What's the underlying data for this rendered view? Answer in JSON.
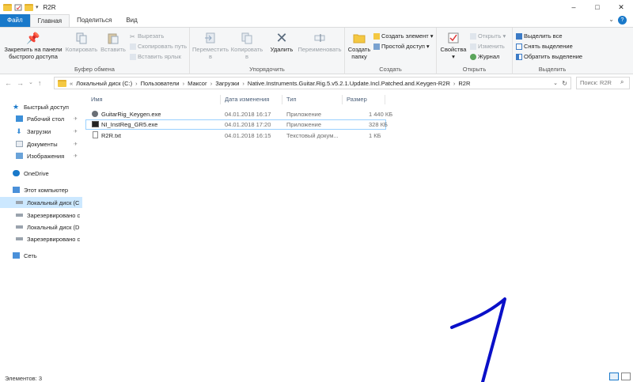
{
  "window": {
    "title": "R2R",
    "minimize": "–",
    "maximize": "□",
    "close": "✕"
  },
  "tabs": [
    "Файл",
    "Главная",
    "Поделиться",
    "Вид"
  ],
  "ribbon": {
    "clipboard": {
      "label": "Буфер обмена",
      "pin": "Закрепить на панели быстрого доступа",
      "copy": "Копировать",
      "paste": "Вставить",
      "cut": "Вырезать",
      "copy_path": "Скопировать путь",
      "paste_shortcut": "Вставить ярлык"
    },
    "organize": {
      "label": "Упорядочить",
      "move_to": "Переместить в",
      "copy_to": "Копировать в",
      "delete": "Удалить",
      "rename": "Переименовать"
    },
    "create": {
      "label": "Создать",
      "new_folder": "Создать папку",
      "new_item": "Создать элемент",
      "easy_access": "Простой доступ"
    },
    "open": {
      "label": "Открыть",
      "properties": "Свойства",
      "open": "Открыть",
      "edit": "Изменить",
      "history": "Журнал"
    },
    "select": {
      "label": "Выделить",
      "select_all": "Выделить все",
      "select_none": "Снять выделение",
      "invert": "Обратить выделение"
    }
  },
  "address": {
    "crumbs": [
      "Локальный диск (C:)",
      "Пользователи",
      "Максог",
      "Загрузки",
      "Native.Instruments.Guitar.Rig.5.v5.2.1.Update.Incl.Patched.and.Keygen-R2R",
      "R2R"
    ],
    "search_placeholder": "Поиск: R2R",
    "prefix": "«"
  },
  "sidebar": [
    {
      "label": "Быстрый доступ",
      "icon": "star-icon",
      "pinned": false
    },
    {
      "label": "Рабочий стол",
      "icon": "desktop-icon",
      "pinned": true
    },
    {
      "label": "Загрузки",
      "icon": "download-icon",
      "pinned": true
    },
    {
      "label": "Документы",
      "icon": "documents-icon",
      "pinned": true
    },
    {
      "label": "Изображения",
      "icon": "pictures-icon",
      "pinned": true
    },
    {
      "label": "OneDrive",
      "icon": "cloud-icon",
      "pinned": false
    },
    {
      "label": "Этот компьютер",
      "icon": "computer-icon",
      "pinned": false
    },
    {
      "label": "Локальный диск (C",
      "icon": "drive-icon",
      "pinned": false
    },
    {
      "label": "Зарезервировано с",
      "icon": "drive-icon",
      "pinned": false
    },
    {
      "label": "Локальный диск (D",
      "icon": "drive-icon",
      "pinned": false
    },
    {
      "label": "Зарезервировано с",
      "icon": "drive-icon",
      "pinned": false
    },
    {
      "label": "Сеть",
      "icon": "network-icon",
      "pinned": false
    }
  ],
  "pin_glyph": "✈",
  "columns": [
    "Имя",
    "Дата изменения",
    "Тип",
    "Размер"
  ],
  "files": [
    {
      "name": "GuitarRig_Keygen.exe",
      "date": "04.01.2018 16:17",
      "type": "Приложение",
      "size": "1 440 КБ",
      "icon": "app-icon"
    },
    {
      "name": "NI_InstReg_GR5.exe",
      "date": "04.01.2018 17:20",
      "type": "Приложение",
      "size": "328 КБ",
      "icon": "app-icon"
    },
    {
      "name": "R2R.txt",
      "date": "04.01.2018 16:15",
      "type": "Текстовый докум...",
      "size": "1 КБ",
      "icon": "text-file-icon"
    }
  ],
  "status": "Элементов: 3",
  "colors": {
    "accent": "#1979ca",
    "selection": "#cce8ff",
    "annotation": "#0a10c8"
  }
}
